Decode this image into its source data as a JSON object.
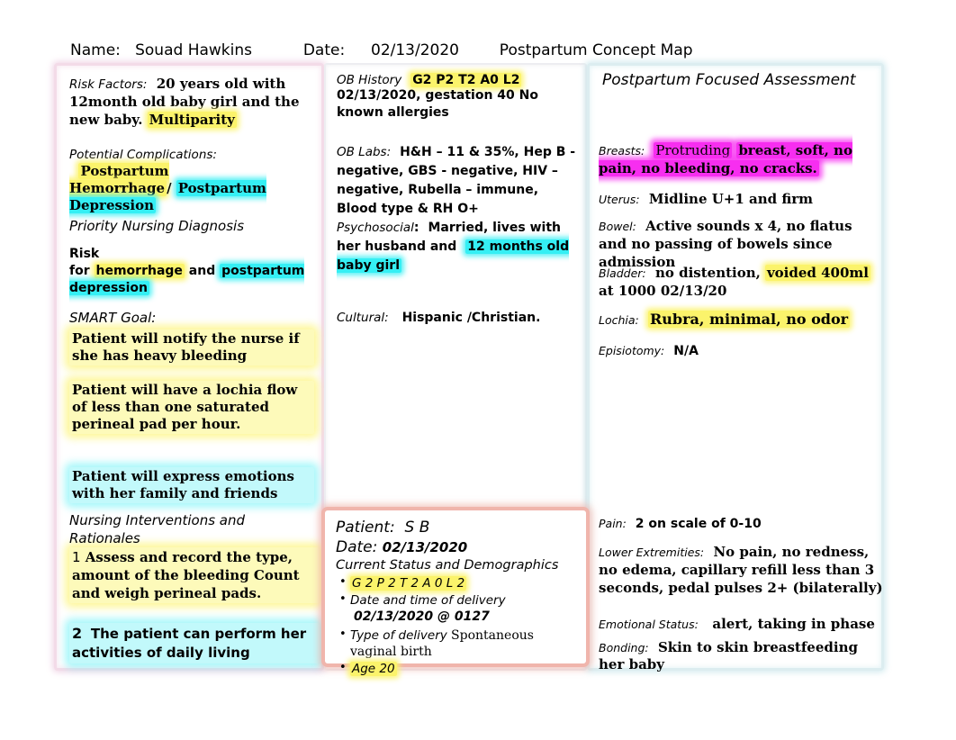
{
  "header": {
    "name_label": "Name:",
    "name_value": "Souad Hawkins",
    "date_label": "Date:",
    "date_value": "02/13/2020",
    "doc_title": "Postpartum Concept Map"
  },
  "left_panel": {
    "risk_factors": {
      "label": "Risk Factors:",
      "text_plain": "20 years old with 12month old baby girl and the new baby.",
      "highlight_yellow": "Multiparity"
    },
    "potential_complications": {
      "label": "Potential Complications:",
      "highlight_yellow": "Postpartum Hemorrhage",
      "separator": "/",
      "highlight_cyan": "Postpartum Depression"
    },
    "priority_nursing_diagnosis": {
      "title": "Priority Nursing Diagnosis",
      "prefix": "Risk for",
      "highlight_yellow": "hemorrhage",
      "middle": "and",
      "highlight_cyan": "postpartum depression"
    },
    "smart_goal": {
      "title": "SMART Goal:",
      "goal_1": "Patient will notify the nurse if she has heavy bleeding",
      "goal_2": "Patient will have a lochia flow of less than one saturated perineal pad per hour.",
      "goal_3": "Patient will express emotions with her family and friends"
    },
    "interventions": {
      "title": "Nursing Interventions and Rationales",
      "item_1_number": "1",
      "item_1_text": "Assess and record the type, amount of the bleeding Count and weigh perineal pads.",
      "item_2_number": "2",
      "item_2_text": "The patient can perform her activities of daily living"
    }
  },
  "middle_panel": {
    "ob_history": {
      "label": "OB History",
      "highlight_yellow": "G2 P2 T2 A0 L2",
      "text": "02/13/2020, gestation 40 No known allergies"
    },
    "ob_labs": {
      "label": "OB Labs:",
      "text": "H&H – 11 & 35%, Hep B - negative, GBS - negative, HIV – negative, Rubella – immune, Blood type & RH O+"
    },
    "psychosocial": {
      "label": "Psychosocial",
      "colon": ":",
      "text": "Married, lives with her husband and",
      "highlight_cyan": "12 months old baby girl"
    },
    "cultural": {
      "label": "Cultural:",
      "text": "Hispanic /Christian."
    }
  },
  "patient_card": {
    "patient_label": "Patient:",
    "patient_value": "S B",
    "date_label": "Date:",
    "date_value": "02/13/2020",
    "section_title": "Current Status and Demographics",
    "bullets": [
      {
        "text": "G 2 P 2 T 2 A 0 L 2",
        "highlight": "yellow",
        "bold_suffix": ""
      },
      {
        "text": "Date and time of delivery",
        "highlight": "none",
        "bold_suffix": "02/13/2020 @ 0127"
      },
      {
        "text": "Type of delivery",
        "highlight": "none",
        "bold_suffix": "Spontaneous vaginal birth"
      },
      {
        "text": "Age 20",
        "highlight": "yellow",
        "bold_suffix": ""
      }
    ]
  },
  "right_panel": {
    "title": "Postpartum Focused Assessment",
    "breasts": {
      "label": "Breasts:",
      "highlight_magenta_lead": "Protruding",
      "text": "breast, soft, no pain, no bleeding, no cracks."
    },
    "uterus": {
      "label": "Uterus:",
      "text": "Midline U+1 and firm"
    },
    "bowel": {
      "label": "Bowel:",
      "text": "Active sounds x 4, no flatus and no passing of bowels since admission"
    },
    "bladder": {
      "label": "Bladder:",
      "text_pre": "no distention,",
      "highlight_yellow": "voided 400ml",
      "text_post": "at 1000 02/13/20"
    },
    "lochia": {
      "label": "Lochia:",
      "highlight_yellow": "Rubra, minimal, no odor"
    },
    "episiotomy": {
      "label": "Episiotomy:",
      "text": "N/A"
    },
    "pain": {
      "label": "Pain:",
      "text": "2 on scale of 0-10"
    },
    "lower_extremities": {
      "label": "Lower Extremities:",
      "text": "No pain, no redness, no edema, capillary refill less than 3 seconds, pedal pulses 2+ (bilaterally)"
    },
    "emotional_status": {
      "label": "Emotional Status:",
      "text": "alert, taking in phase"
    },
    "bonding": {
      "label": "Bonding:",
      "text": "Skin to skin breastfeeding her baby"
    }
  },
  "colors": {
    "highlight_yellow": "#fbf36b",
    "highlight_cyan": "#35eff4",
    "highlight_magenta": "#f72ef0",
    "border_left_panel": "#f3dbe8",
    "border_right_panel": "#dcedf0",
    "border_patient_card": "#f0b5ac"
  }
}
